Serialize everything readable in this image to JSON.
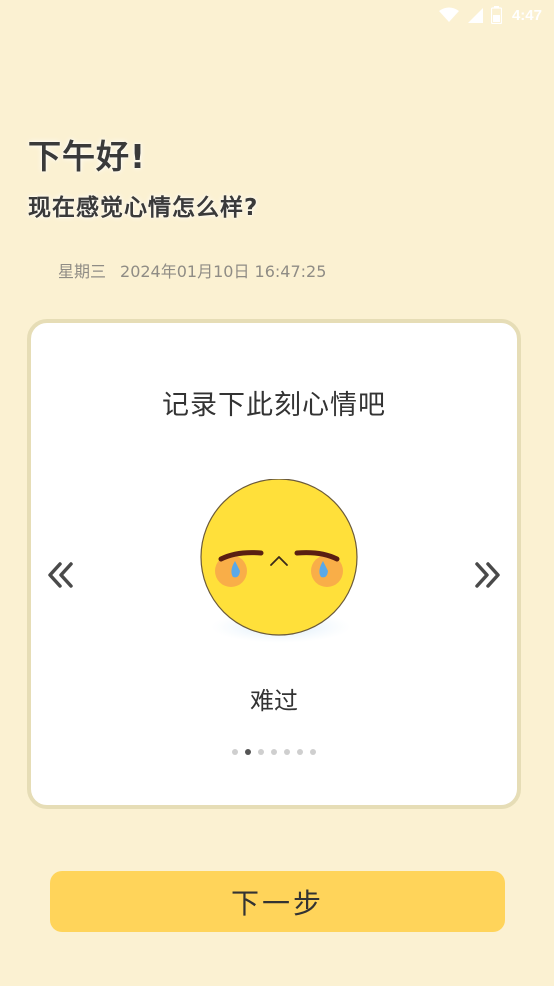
{
  "status_bar": {
    "time": "4:47",
    "icons": [
      "wifi-icon",
      "signal-icon",
      "battery-icon"
    ]
  },
  "header": {
    "greeting": "下午好!",
    "question": "现在感觉心情怎么样?",
    "weekday": "星期三",
    "datetime": "2024年01月10日 16:47:25"
  },
  "card": {
    "title": "记录下此刻心情吧",
    "prev_icon": "double-chevron-left-icon",
    "next_icon": "double-chevron-right-icon",
    "mood_icon": "crying-face-icon",
    "mood_label": "难过",
    "pager": {
      "count": 7,
      "active_index": 1
    }
  },
  "footer": {
    "next_label": "下一步"
  },
  "colors": {
    "background": "#FBF1D2",
    "card_border": "#E6DDB6",
    "button": "#FFD45A",
    "emoji_face": "#FFE03A"
  }
}
